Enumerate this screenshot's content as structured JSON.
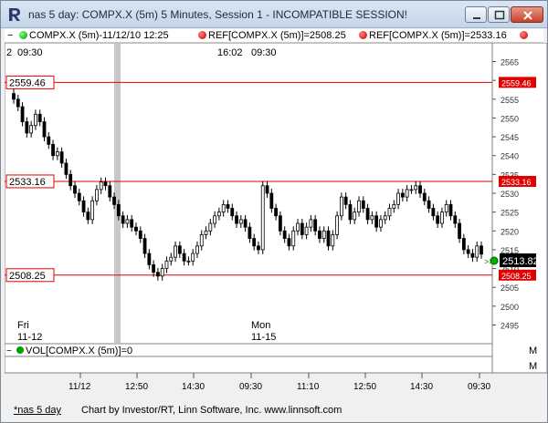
{
  "window": {
    "title": "nas 5 day: COMPX.X (5m) 5 Minutes, Session 1 - INCOMPATIBLE SESSION!",
    "app_icon": "linn-software-r-logo"
  },
  "legend": {
    "collapse_marker": "−",
    "items": [
      {
        "dot": "green",
        "text": "COMPX.X (5m)-11/12/10 12:25"
      },
      {
        "dot": "red",
        "text": "REF[COMPX.X (5m)]=2508.25"
      },
      {
        "dot": "red",
        "text": "REF[COMPX.X (5m)]=2533.16"
      }
    ],
    "close_marker": "M"
  },
  "top_time_labels": [
    "2",
    "09:30",
    "16:02",
    "09:30"
  ],
  "price_axis": {
    "ticks": [
      "2565",
      "2560",
      "2555",
      "2550",
      "2545",
      "2540",
      "2535",
      "2530",
      "2525",
      "2520",
      "2515",
      "2510",
      "2505",
      "2500",
      "2495"
    ],
    "current_price": "2513.82",
    "ref_labels": [
      "2559.46",
      "2533.16",
      "2508.25"
    ]
  },
  "ref_lines": [
    {
      "label": "2559.46",
      "color": "#e00000"
    },
    {
      "label": "2533.16",
      "color": "#e00000"
    },
    {
      "label": "2508.25",
      "color": "#e00000"
    }
  ],
  "day_labels": [
    {
      "weekday": "Fri",
      "date": "11-12"
    },
    {
      "weekday": "Mon",
      "date": "11-15"
    }
  ],
  "volume_pane": {
    "legend": "VOL[COMPX.X (5m)]=0",
    "close_marker": "M"
  },
  "time_axis": {
    "ticks": [
      "11/12",
      "12:50",
      "14:30",
      "09:30",
      "11:10",
      "12:50",
      "14:30",
      "09:30"
    ]
  },
  "status": {
    "tab": "*nas 5 day",
    "credit": "Chart by Investor/RT, Linn Software, Inc. www.linnsoft.com"
  },
  "colors": {
    "ref_line": "#e00000",
    "up_candle": "#ffffff",
    "down_candle": "#000000",
    "current_price_bg": "#000000",
    "session_break": "#c8c8c8"
  },
  "chart_data": {
    "type": "candlestick",
    "ylim": [
      2491,
      2569
    ],
    "closes": [
      2555,
      2553,
      2549,
      2546,
      2548,
      2551,
      2549,
      2545,
      2543,
      2540,
      2541,
      2538,
      2535,
      2532,
      2530,
      2528,
      2525,
      2523,
      2528,
      2531,
      2533,
      2532,
      2529,
      2527,
      2524,
      2522,
      2523,
      2521,
      2520,
      2518,
      2514,
      2511,
      2509,
      2508,
      2510,
      2512,
      2513,
      2516,
      2514,
      2512,
      2512,
      2514,
      2516,
      2519,
      2520,
      2522,
      2524,
      2525,
      2527,
      2526,
      2524,
      2522,
      2523,
      2521,
      2518,
      2516,
      2515,
      2532,
      2530,
      2526,
      2524,
      2520,
      2518,
      2516,
      2520,
      2522,
      2519,
      2521,
      2523,
      2520,
      2518,
      2520,
      2516,
      2519,
      2524,
      2529,
      2527,
      2523,
      2525,
      2528,
      2526,
      2523,
      2524,
      2521,
      2523,
      2524,
      2526,
      2527,
      2530,
      2529,
      2531,
      2531,
      2532,
      2530,
      2528,
      2526,
      2524,
      2522,
      2525,
      2527,
      2524,
      2522,
      2518,
      2515,
      2514,
      2513,
      2516,
      2513.82
    ]
  }
}
